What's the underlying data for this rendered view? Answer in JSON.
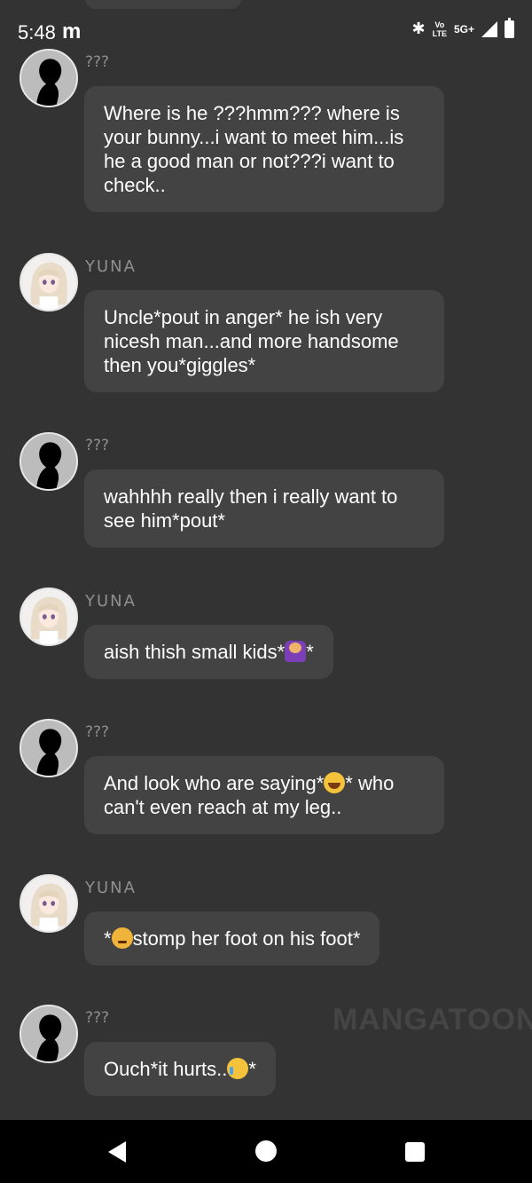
{
  "status_bar": {
    "time": "5:48",
    "app_glyph": "m",
    "bluetooth_icon": "✱",
    "volte": "Vo\nLTE",
    "network": "5G+"
  },
  "characters": {
    "unknown_name": "???",
    "yuna_name": "YUNA"
  },
  "messages": [
    {
      "speaker": "???",
      "avatar": "silhouette-avatar",
      "text": "Where is he ???hmm??? where is your bunny...i want to meet him...is he a good man or not???i want to check.."
    },
    {
      "speaker": "YUNA",
      "avatar": "yuna-avatar",
      "text": "Uncle*pout in anger* he ish very nicesh man...and more handsome then you*giggles*"
    },
    {
      "speaker": "???",
      "avatar": "silhouette-avatar",
      "text": "wahhhh really then i really want to see him*pout*"
    },
    {
      "speaker": "YUNA",
      "avatar": "yuna-avatar",
      "text_before": "aish thish small kids*",
      "emoji": "facepalm-emoji",
      "text_after": "*"
    },
    {
      "speaker": "???",
      "avatar": "silhouette-avatar",
      "text_before": "And look who are saying*",
      "emoji": "laughing-crying-emoji",
      "text_after": "* who can't even reach at my leg.."
    },
    {
      "speaker": "YUNA",
      "avatar": "yuna-avatar",
      "text_before": "*",
      "emoji": "angry-face-emoji",
      "text_after": "stomp her foot on his foot*"
    },
    {
      "speaker": "???",
      "avatar": "silhouette-avatar",
      "text_before": "Ouch*it hurts..",
      "emoji": "crying-face-emoji",
      "text_after": "*"
    }
  ],
  "watermark": "MANGATOON",
  "nav": {
    "back": "back-icon",
    "home": "home-icon",
    "recents": "recents-icon"
  },
  "colors": {
    "background": "#333333",
    "bubble": "#434343",
    "name": "#8f8f8f",
    "nav_bar": "#000000"
  }
}
